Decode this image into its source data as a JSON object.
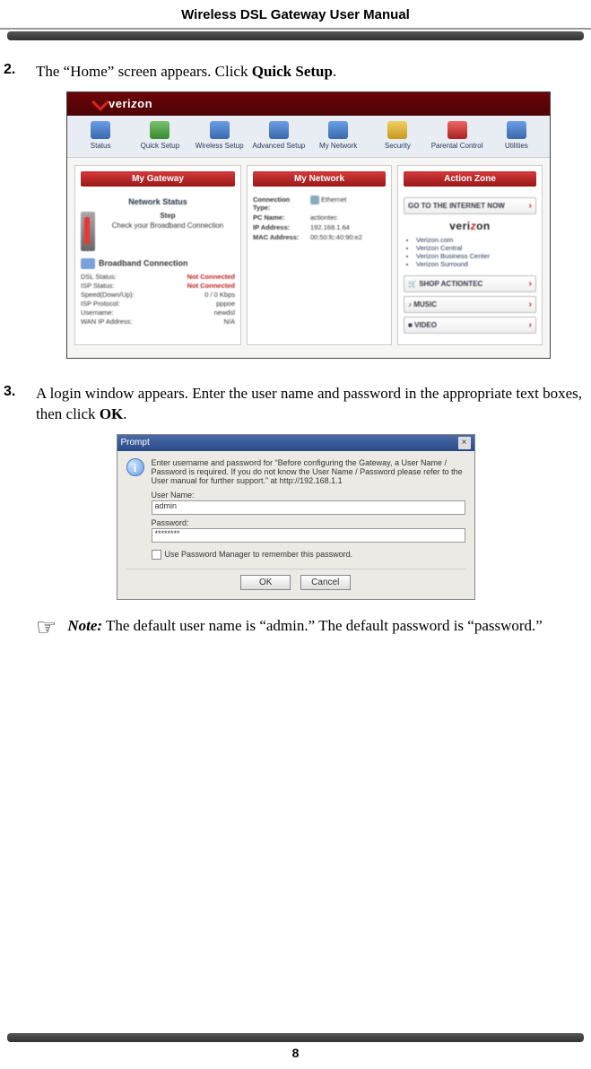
{
  "header": {
    "title": "Wireless DSL Gateway User Manual"
  },
  "steps": {
    "s2": {
      "num": "2.",
      "pre": "The “Home” screen appears. Click ",
      "bold": "Quick Setup",
      "post": "."
    },
    "s3": {
      "num": "3.",
      "pre": " A login window appears. Enter the user name and password in the appropriate text boxes, then click ",
      "bold": "OK",
      "post": "."
    }
  },
  "gateway": {
    "logo": "verizon",
    "nav": [
      {
        "label": "Status"
      },
      {
        "label": "Quick Setup"
      },
      {
        "label": "Wireless Setup"
      },
      {
        "label": "Advanced Setup"
      },
      {
        "label": "My Network"
      },
      {
        "label": "Security"
      },
      {
        "label": "Parental Control"
      },
      {
        "label": "Utilities"
      }
    ],
    "gatewayPanel": {
      "title": "My Gateway",
      "networkStatus": "Network Status",
      "step": "Step",
      "check": "Check your Broadband Connection",
      "bbTitle": "Broadband Connection",
      "rows": [
        {
          "k": "DSL Status:",
          "v": "Not Connected",
          "red": true
        },
        {
          "k": "ISP Status:",
          "v": "Not Connected",
          "red": true
        },
        {
          "k": "Speed(Down/Up):",
          "v": "0 / 0 Kbps"
        },
        {
          "k": "ISP Protocol:",
          "v": "pppoe"
        },
        {
          "k": "Username:",
          "v": "newdsl"
        },
        {
          "k": "WAN IP Address:",
          "v": "N/A"
        }
      ]
    },
    "networkPanel": {
      "title": "My Network",
      "rows": [
        {
          "k": "Connection Type:",
          "v": "Ethernet"
        },
        {
          "k": "PC Name:",
          "v": "actiontec"
        },
        {
          "k": "IP Address:",
          "v": "192.168.1.64"
        },
        {
          "k": "MAC Address:",
          "v": "00:50:fc:40:90:e2"
        }
      ]
    },
    "actionPanel": {
      "title": "Action Zone",
      "goBtn": "GO TO THE INTERNET NOW",
      "links": [
        "Verizon.com",
        "Verizon Central",
        "Verizon Business Center",
        "Verizon Surround"
      ],
      "shop": "SHOP ACTIONTEC",
      "music": "MUSIC",
      "video": "VIDEO"
    }
  },
  "login": {
    "title": "Prompt",
    "msg": "Enter username and password for “Before configuring the Gateway, a User Name / Password is required. If you do not know the User Name / Password please refer to the User manual for further support.” at http://192.168.1.1",
    "userLabel": "User Name:",
    "userValue": "admin",
    "passLabel": "Password:",
    "passValue": "********",
    "remember": "Use Password Manager to remember this password.",
    "ok": "OK",
    "cancel": "Cancel"
  },
  "note": {
    "label": "Note:",
    "text": " The default user name is “admin.” The default password is “password.”"
  },
  "footer": {
    "page": "8"
  }
}
